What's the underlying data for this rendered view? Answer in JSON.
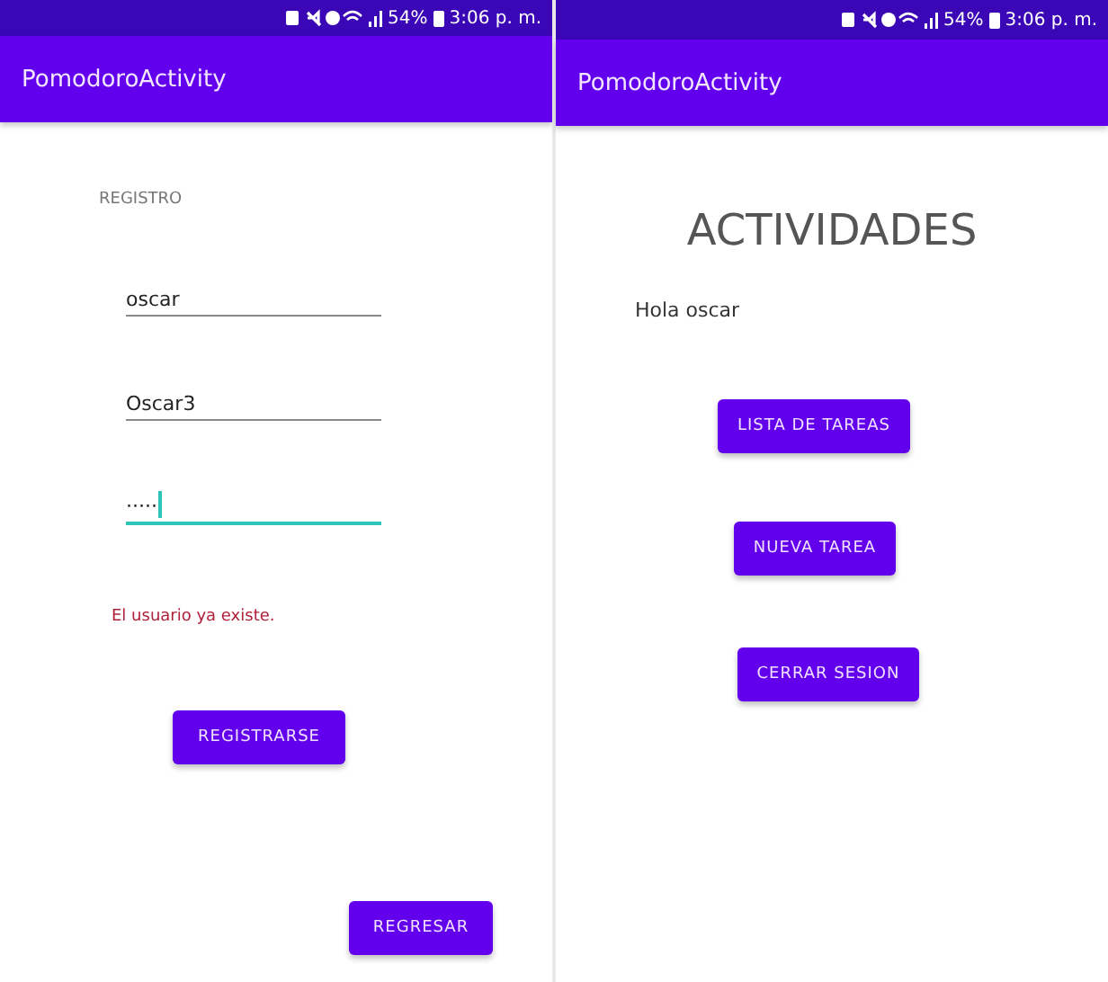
{
  "screens": [
    {
      "kind": "registro",
      "status_bar": {
        "battery": "54%",
        "time": "3:06 p. m."
      },
      "app_bar": {
        "title": "PomodoroActivity"
      },
      "heading": "REGISTRO",
      "fields": [
        {
          "value": "oscar",
          "focused": false
        },
        {
          "value": "Oscar3",
          "focused": false
        },
        {
          "value": "·····",
          "focused": true
        }
      ],
      "error": "El usuario ya existe.",
      "buttons": [
        "REGISTRARSE",
        "REGRESAR"
      ]
    },
    {
      "kind": "actividades",
      "status_bar": {
        "battery": "54%",
        "time": "3:06 p. m."
      },
      "app_bar": {
        "title": "PomodoroActivity"
      },
      "heading": "ACTIVIDADES",
      "greeting": "Hola oscar",
      "buttons": [
        "LISTA DE TAREAS",
        "NUEVA TAREA",
        "CERRAR SESION"
      ]
    }
  ]
}
